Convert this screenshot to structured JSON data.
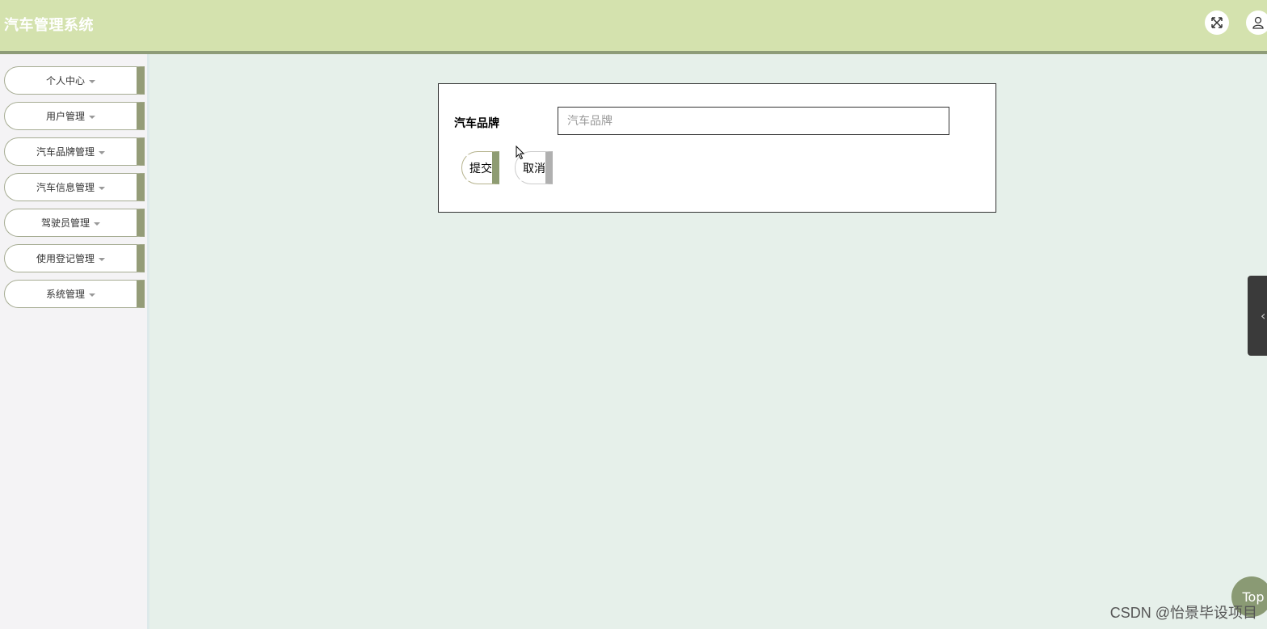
{
  "header": {
    "title": "汽车管理系统",
    "icons": [
      "fullscreen-icon",
      "user-icon"
    ],
    "background": "#d4e2ae"
  },
  "sidebar": {
    "items": [
      {
        "label": "个人中心"
      },
      {
        "label": "用户管理"
      },
      {
        "label": "汽车品牌管理"
      },
      {
        "label": "汽车信息管理"
      },
      {
        "label": "驾驶员管理"
      },
      {
        "label": "使用登记管理"
      },
      {
        "label": "系统管理"
      }
    ]
  },
  "form": {
    "field_label": "汽车品牌",
    "field_placeholder": "汽车品牌",
    "field_value": "",
    "submit_label": "提交",
    "cancel_label": "取消"
  },
  "top_button": "Top",
  "watermark": "CSDN @怡景毕设项目",
  "colors": {
    "accent": "#949c78",
    "background": "#e6f0ea"
  }
}
